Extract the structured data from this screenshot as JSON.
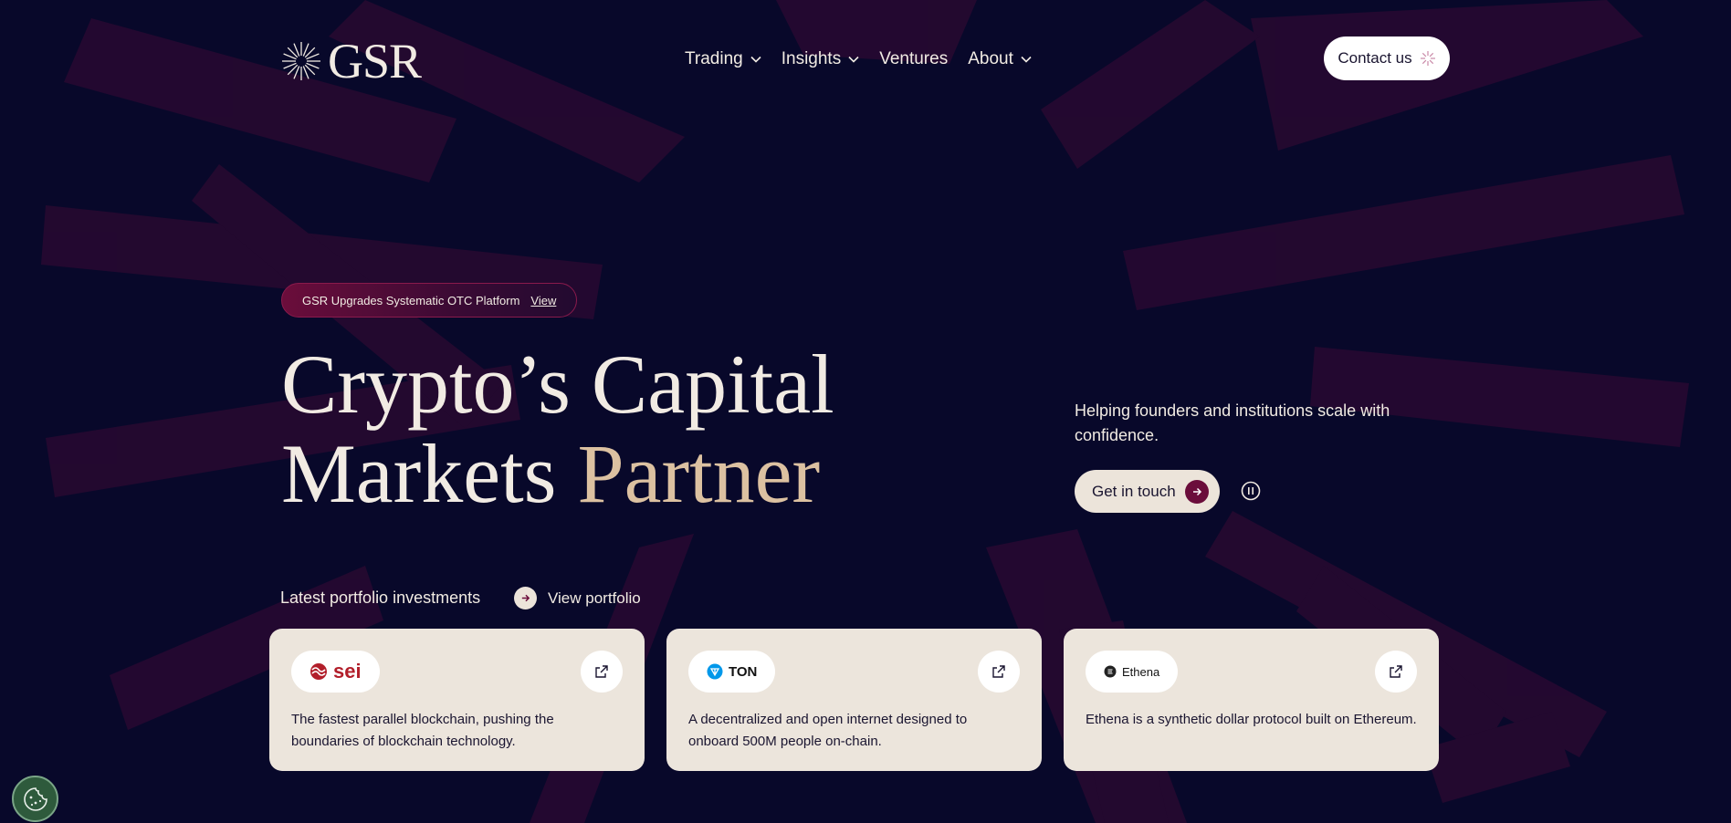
{
  "header": {
    "logo_text": "GSR",
    "nav": [
      {
        "label": "Trading",
        "has_dropdown": true
      },
      {
        "label": "Insights",
        "has_dropdown": true
      },
      {
        "label": "Ventures",
        "has_dropdown": false
      },
      {
        "label": "About",
        "has_dropdown": true
      }
    ],
    "contact_label": "Contact us"
  },
  "announcement": {
    "text": "GSR Upgrades Systematic OTC Platform",
    "link_label": "View"
  },
  "hero": {
    "title_line1": "Crypto’s Capital",
    "title_line2_a": "Markets ",
    "title_line2_b": "Partner",
    "tagline": "Helping founders and institutions scale with confidence.",
    "cta_label": "Get in touch"
  },
  "portfolio": {
    "heading": "Latest portfolio investments",
    "view_label": "View portfolio",
    "cards": [
      {
        "name": "sei",
        "icon": "sei-logo-icon",
        "description": "The fastest parallel blockchain, pushing the boundaries of blockchain technology."
      },
      {
        "name": "TON",
        "icon": "ton-logo-icon",
        "description": "A decentralized and open internet designed to onboard 500M people on-chain."
      },
      {
        "name": "Ethena",
        "icon": "ethena-logo-icon",
        "description": "Ethena is a synthetic dollar protocol built on Ethereum."
      }
    ]
  },
  "colors": {
    "background": "#08082a",
    "cream": "#f1ebe3",
    "accent_gold": "#dcc1a1",
    "maroon": "#6b0d3b",
    "card_bg": "#ece5dc"
  }
}
